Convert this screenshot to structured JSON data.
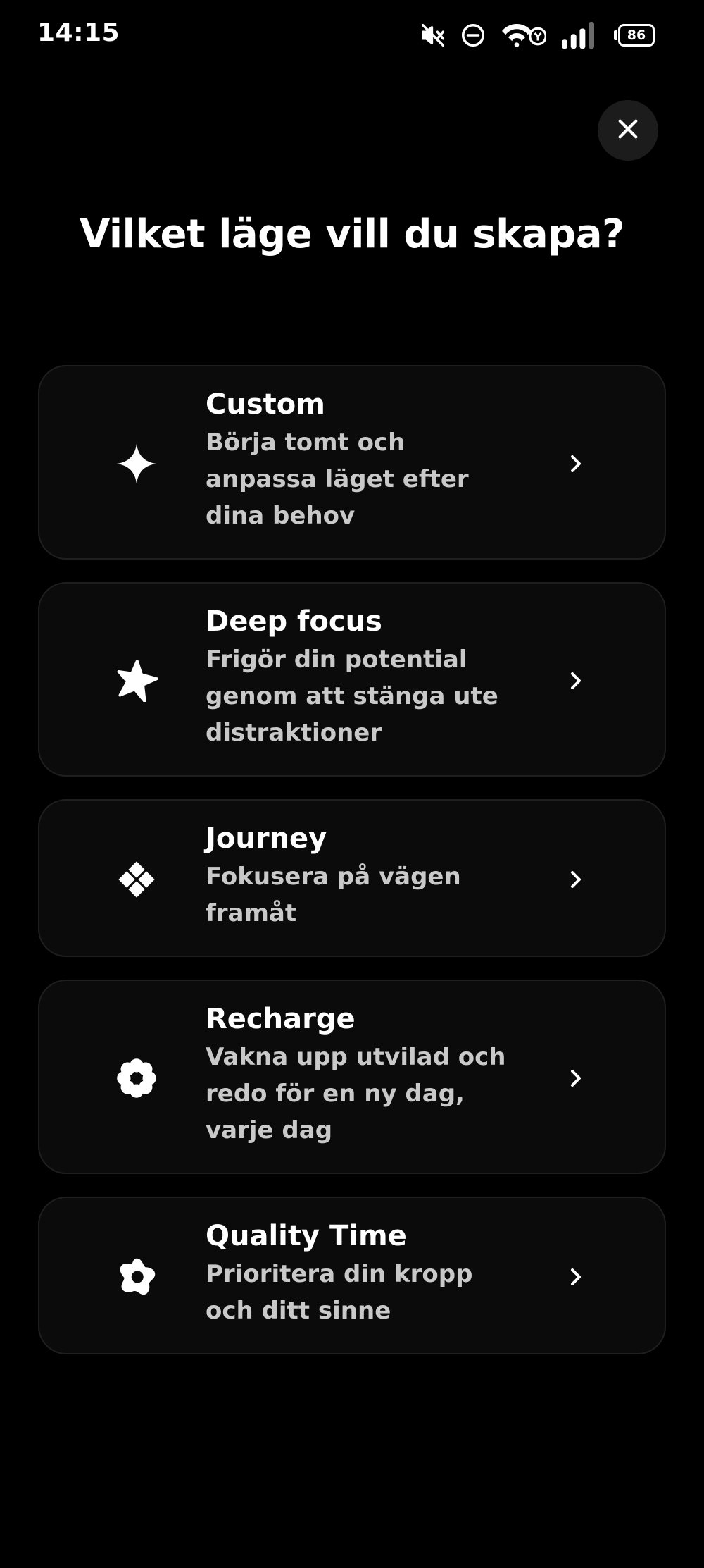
{
  "status_bar": {
    "time": "14:15",
    "battery_level": "86",
    "icons": [
      "mute-icon",
      "do-not-disturb-icon",
      "wifi-icon",
      "signal-icon",
      "battery-icon"
    ]
  },
  "header": {
    "title": "Vilket läge vill du skapa?",
    "close_icon": "close-icon"
  },
  "modes": [
    {
      "title": "Custom",
      "description_lines": [
        "Börja tomt och",
        "anpassa läget efter",
        "dina behov"
      ],
      "icon": "sparkle-icon"
    },
    {
      "title": "Deep focus",
      "description_lines": [
        "Frigör din potential",
        "genom att stänga ute",
        "distraktioner"
      ],
      "icon": "pinwheel-star-icon"
    },
    {
      "title": "Journey",
      "description_lines": [
        "Fokusera på vägen",
        "framåt"
      ],
      "icon": "diamond-cluster-icon"
    },
    {
      "title": "Recharge",
      "description_lines": [
        "Vakna upp utvilad och",
        "redo för en ny dag,",
        "varje dag"
      ],
      "icon": "flower-icon"
    },
    {
      "title": "Quality Time",
      "description_lines": [
        "Prioritera din kropp",
        "och ditt sinne"
      ],
      "icon": "blob-flower-icon"
    }
  ],
  "colors": {
    "background": "#000000",
    "card_background": "#0b0b0b",
    "card_border": "#1f1f1f",
    "title_text": "#ffffff",
    "description_text": "#c9c9c9",
    "close_button_background": "#1c1c1c"
  }
}
